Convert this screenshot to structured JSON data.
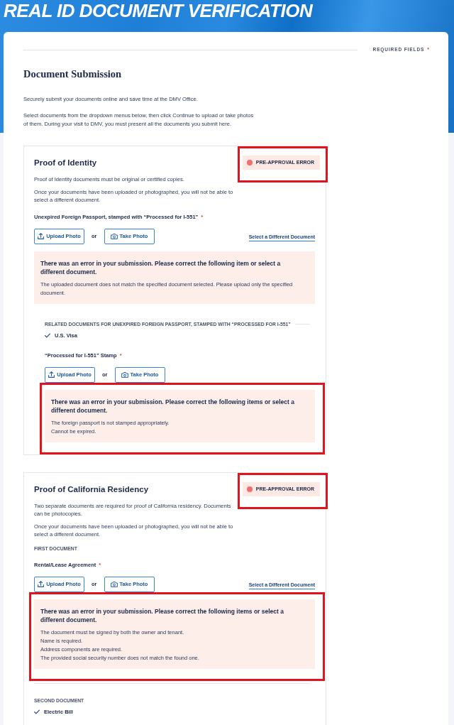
{
  "banner": {
    "title": "REAL ID DOCUMENT VERIFICATION"
  },
  "required_note": {
    "label": "REQUIRED FIELDS",
    "mark": "*"
  },
  "page_title": "Document Submission",
  "intro": [
    "Securely submit your documents online and save time at the DMV Office.",
    "Select documents from the dropdown menus below, then click Continue to upload or take photos of them. During your visit to DMV, you must present all the documents you submit here."
  ],
  "sections": [
    {
      "title": "Proof of Identity",
      "badge": {
        "label": "PRE-APPROVAL ERROR",
        "highlighted": true
      },
      "notes": [
        "Proof of Identity documents must be original or certified copies.",
        "Once your documents have been uploaded or photographed, you will not be able to select a different document."
      ],
      "blocks": [
        {
          "kind": "upload",
          "label": "Unexpired Foreign Passport, stamped with “Processed for I-551”",
          "required_mark": "*",
          "upload_button": "Upload Photo",
          "separator": "or",
          "photo_button": "Take Photo",
          "change_link": "Select a Different Document",
          "error": {
            "heading": "There was an error in your submission. Please correct the following item or select a different document.",
            "messages": [
              "The uploaded document does not match the specified document selected. Please upload only the specified document."
            ],
            "highlighted": false
          }
        },
        {
          "kind": "related",
          "heading": "RELATED DOCUMENTS FOR UNEXPIRED FOREIGN PASSPORT, STAMPED WITH “PROCESSED FOR I-551”",
          "items": [
            {
              "label": "U.S. Visa",
              "checked": true
            }
          ],
          "uploads": [
            {
              "label": "“Processed for I-551” Stamp",
              "required_mark": "*",
              "upload_button": "Upload Photo",
              "separator": "or",
              "photo_button": "Take Photo",
              "error": {
                "heading": "There was an error in your submission. Please correct the following items or select a different document.",
                "messages": [
                  "The foreign passport is not stamped appropriately.",
                  "Cannot be expired."
                ],
                "highlighted": true
              }
            }
          ]
        }
      ]
    },
    {
      "title": "Proof of California Residency",
      "badge": {
        "label": "PRE-APPROVAL ERROR",
        "highlighted": true
      },
      "notes": [
        "Two separate documents are required for proof of California residency. Documents can be photocopies.",
        "Once your documents have been uploaded or photographed, you will not be able to select a different document."
      ],
      "blocks": [
        {
          "kind": "caption",
          "text": "FIRST DOCUMENT",
          "divider": false
        },
        {
          "kind": "upload",
          "label": "Rental/Lease Agreement",
          "required_mark": "*",
          "upload_button": "Upload Photo",
          "separator": "or",
          "photo_button": "Take Photo",
          "change_link": "Select a Different Document",
          "error": {
            "heading": "There was an error in your submission. Please correct the following items or select a different document.",
            "messages": [
              "The document must be signed by both the owner and tenant.",
              "Name is required.",
              "Address components are required.",
              "The provided social security number does not match the found one."
            ],
            "highlighted": true
          }
        },
        {
          "kind": "caption",
          "text": "SECOND DOCUMENT",
          "divider": true
        },
        {
          "kind": "checklist",
          "items": [
            {
              "label": "Electric Bill",
              "checked": true
            }
          ]
        }
      ]
    }
  ]
}
